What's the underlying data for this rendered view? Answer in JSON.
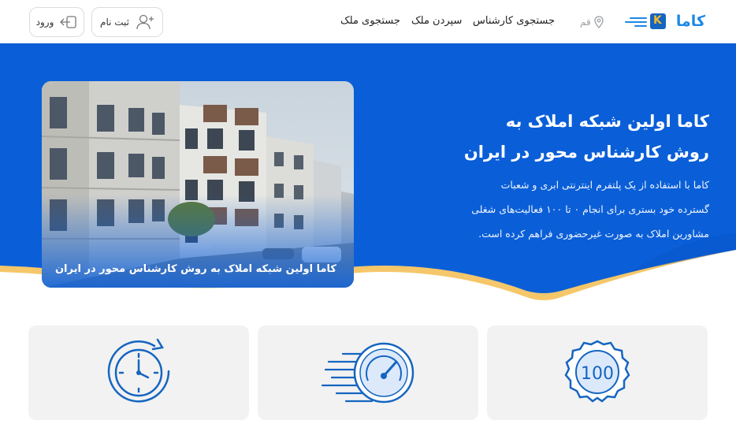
{
  "header": {
    "logo_text": "کاما",
    "city": "قم",
    "nav": [
      "جستجوی کارشناس",
      "سپردن ملک",
      "جستجوی ملک"
    ],
    "register_label": "ثبت نام",
    "login_label": "ورود"
  },
  "hero": {
    "title_line1": "کاما اولین شبکه املاک به",
    "title_line2": "روش کارشناس محور در ایران",
    "desc_line1": "کاما با استفاده از یک پلتفرم اینترنتی ابری و شعبات",
    "desc_line2": "گسترده خود بستری برای انجام ۰ تا ۱۰۰ فعالیت‌های شغلی",
    "desc_line3": "مشاورین املاک به صورت غیرحضوری فراهم کرده است.",
    "image_caption": "کاما اولین شبکه املاک به روش کارشناس محور در ایران"
  },
  "cards": [
    {
      "icon": "clock-icon"
    },
    {
      "icon": "speedometer-icon"
    },
    {
      "icon": "badge-100-icon",
      "badge_text": "100"
    }
  ],
  "colors": {
    "primary": "#0a5fd8",
    "accent": "#f5c76a",
    "card_bg": "#f2f2f2"
  }
}
